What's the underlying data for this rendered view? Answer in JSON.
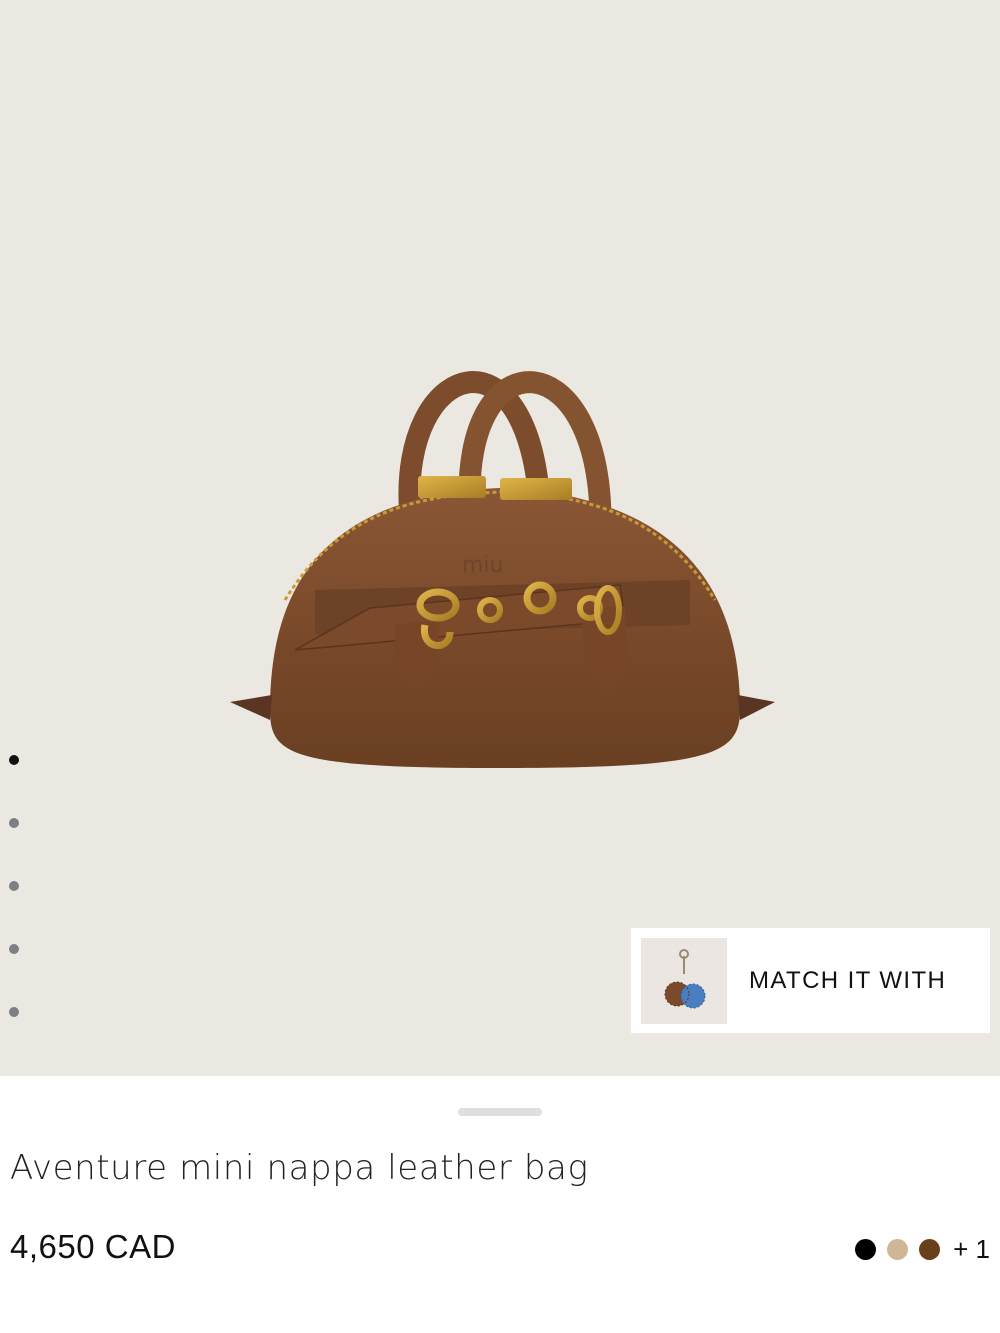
{
  "gallery": {
    "image_alt": "Brown leather bag",
    "dot_count": 5,
    "active_dot": 0
  },
  "match": {
    "label": "MATCH IT WITH",
    "thumb_icon": "bag-charm-icon"
  },
  "product": {
    "title": "Aventure mini nappa leather bag",
    "price": "4,650 CAD"
  },
  "colors": {
    "swatches": [
      "#000000",
      "#cfb796",
      "#6a3f1c"
    ],
    "more": "+ 1"
  }
}
